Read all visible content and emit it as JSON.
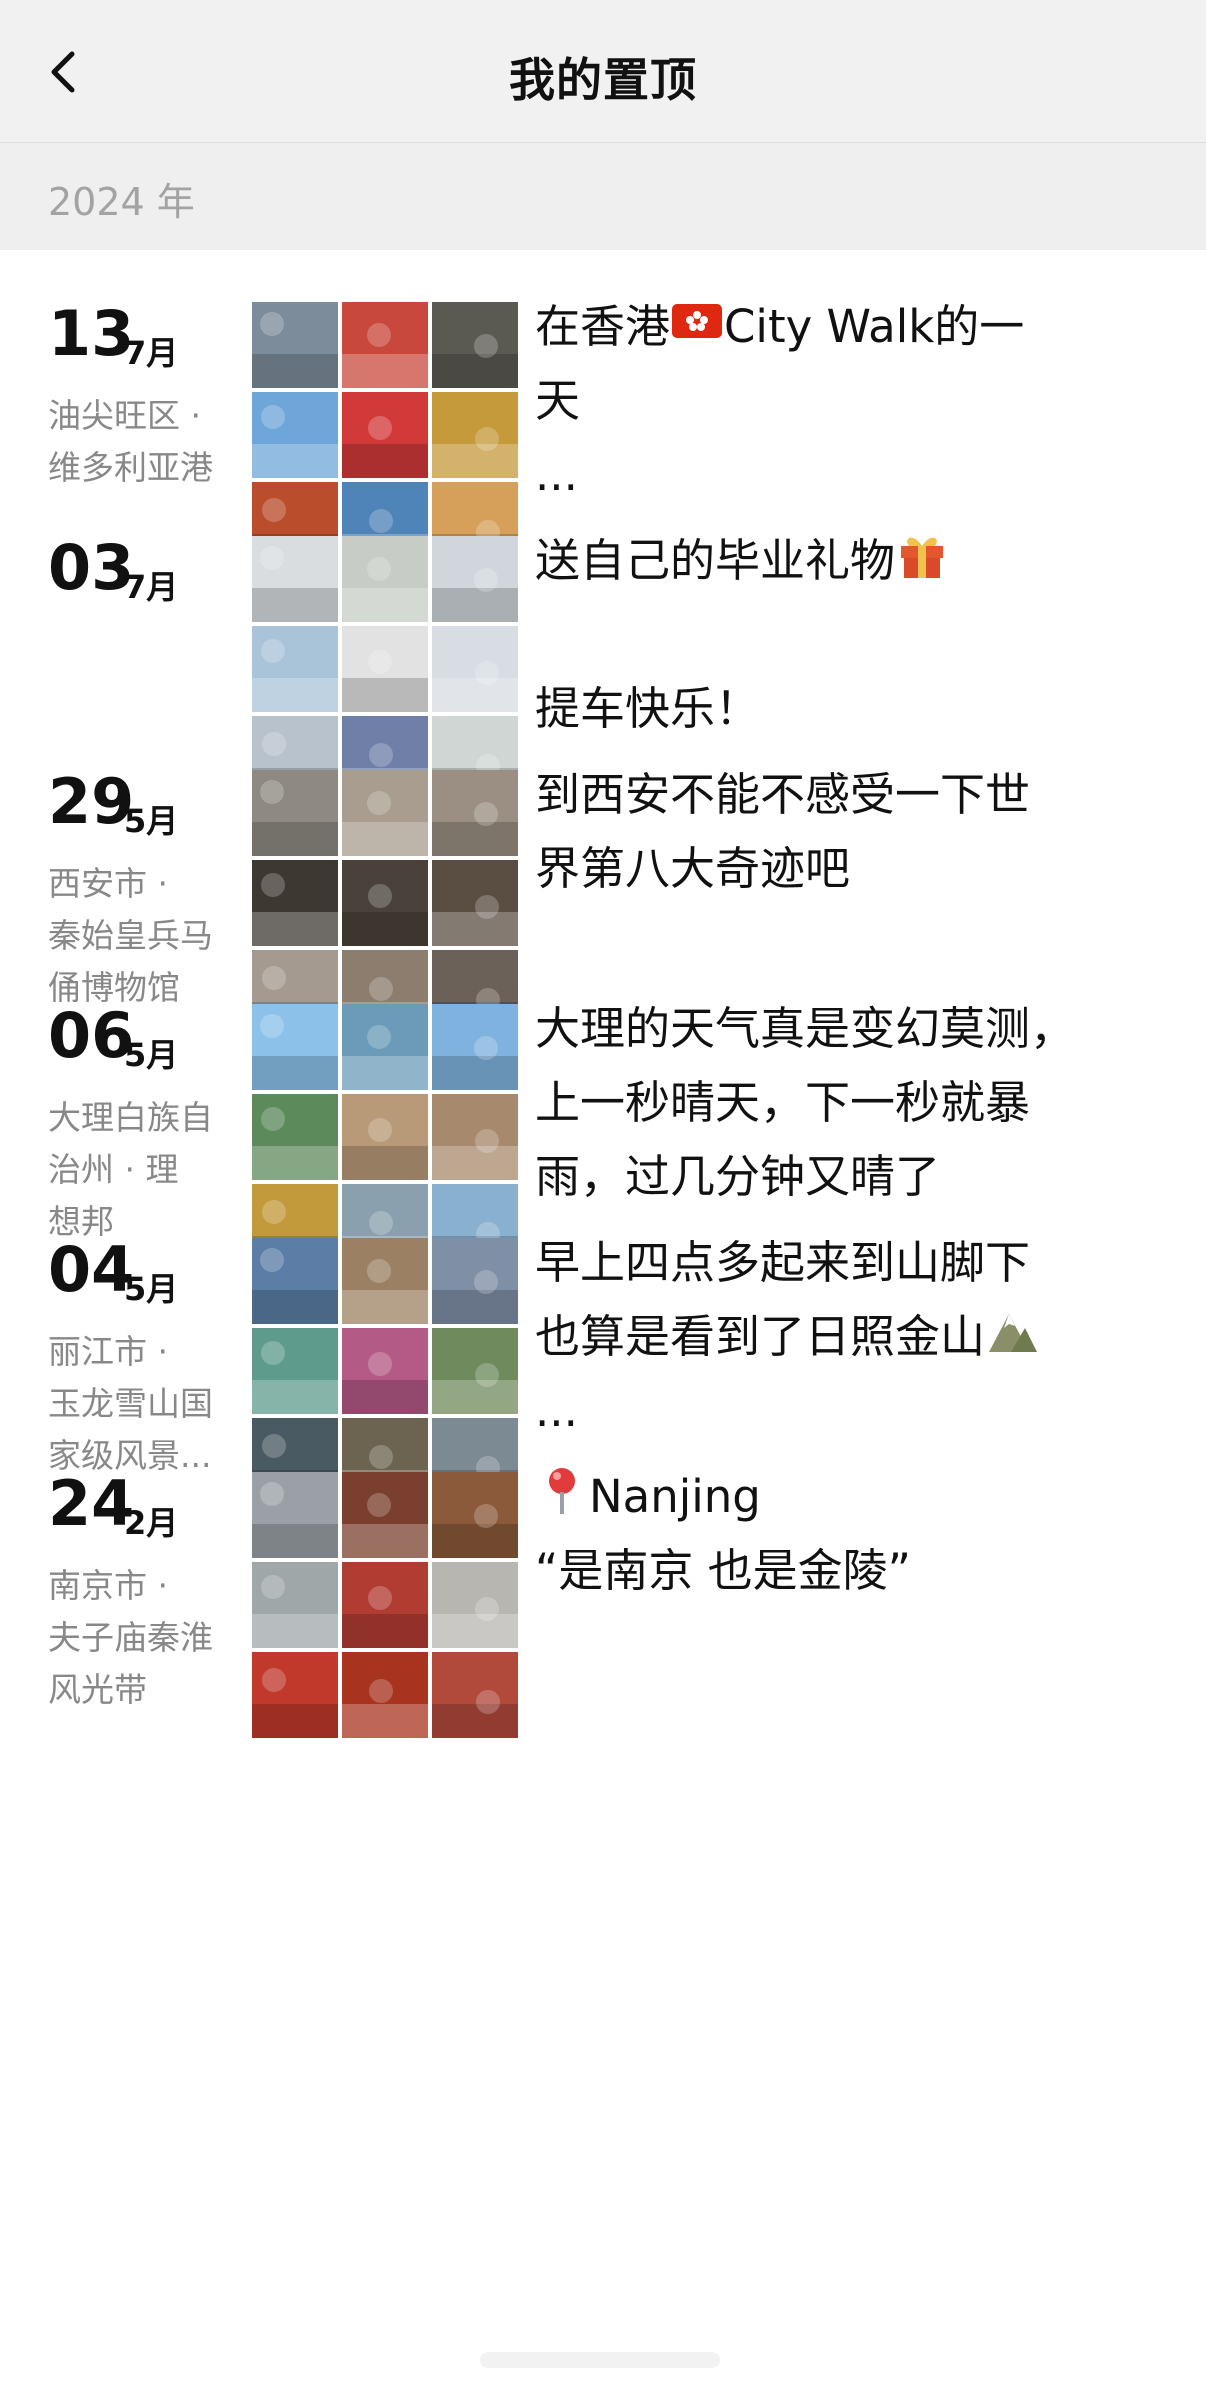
{
  "header": {
    "title": "我的置顶",
    "back_icon": "chevron-left-icon"
  },
  "year_label": "2024 年",
  "posts": [
    {
      "day": "13",
      "month": "7月",
      "location_lines": [
        "油尖旺区 ·",
        "维多利亚港"
      ],
      "text_lines": [
        "在香港{flag}City Walk的一",
        "天",
        "..."
      ],
      "emoji": "hong-kong-flag-icon",
      "photo_colors": [
        "#7d8c9a",
        "#c9483d",
        "#5b5a52",
        "#6fa6d9",
        "#d23a3a",
        "#c49a3a",
        "#b94d2c",
        "#4f84b8",
        "#d6a05a"
      ]
    },
    {
      "day": "03",
      "month": "7月",
      "location_lines": [],
      "text_lines": [
        "送自己的毕业礼物{gift}",
        "",
        "提车快乐！"
      ],
      "emoji": "gift-icon",
      "photo_colors": [
        "#d9dde0",
        "#c7ccc6",
        "#d0d6db",
        "#a9c3d9",
        "#e2e2e2",
        "#d7dde2",
        "#b7c2cc",
        "#6f7fa8",
        "#cfd6d4"
      ]
    },
    {
      "day": "29",
      "month": "5月",
      "location_lines": [
        "西安市 ·",
        "秦始皇兵马",
        "俑博物馆"
      ],
      "text_lines": [
        "到西安不能不感受一下世",
        "界第八大奇迹吧"
      ],
      "emoji": "",
      "photo_colors": [
        "#8e8a82",
        "#a89d8e",
        "#9a8f82",
        "#3e3832",
        "#4a423a",
        "#5a4e42",
        "#a59a8f",
        "#8c7d6e",
        "#6b6158"
      ]
    },
    {
      "day": "06",
      "month": "5月",
      "location_lines": [
        "大理白族自",
        "治州 · 理",
        "想邦"
      ],
      "text_lines": [
        "大理的天气真是变幻莫测，",
        "上一秒晴天，下一秒就暴",
        "雨，过几分钟又晴了"
      ],
      "emoji": "",
      "photo_colors": [
        "#8cc2ea",
        "#6b9bb8",
        "#7fb2de",
        "#5c8a5a",
        "#b99a78",
        "#a78a6d",
        "#c29a3c",
        "#8aa0ae",
        "#8ab0cf"
      ]
    },
    {
      "day": "04",
      "month": "5月",
      "location_lines": [
        "丽江市 ·",
        "玉龙雪山国",
        "家级风景..."
      ],
      "text_lines": [
        "早上四点多起来到山脚下",
        "也算是看到了日照金山{mountain}",
        "..."
      ],
      "emoji": "mountain-icon",
      "photo_colors": [
        "#5c7ea6",
        "#9c8063",
        "#7f8fa6",
        "#5f9b8c",
        "#b35a86",
        "#6f8a5c",
        "#4a5a62",
        "#6c6450",
        "#7c8a94"
      ]
    },
    {
      "day": "24",
      "month": "2月",
      "location_lines": [
        "南京市 ·",
        "夫子庙秦淮",
        "风光带"
      ],
      "text_lines": [
        "{pin}Nanjing",
        "“是南京  也是金陵”"
      ],
      "emoji": "pin-icon",
      "photo_colors": [
        "#9aa0a6",
        "#7a3f2e",
        "#8a5a3a",
        "#9fa7a8",
        "#b13c32",
        "#b8b6b1",
        "#c0392b",
        "#a8341f",
        "#b24a3c"
      ]
    }
  ]
}
